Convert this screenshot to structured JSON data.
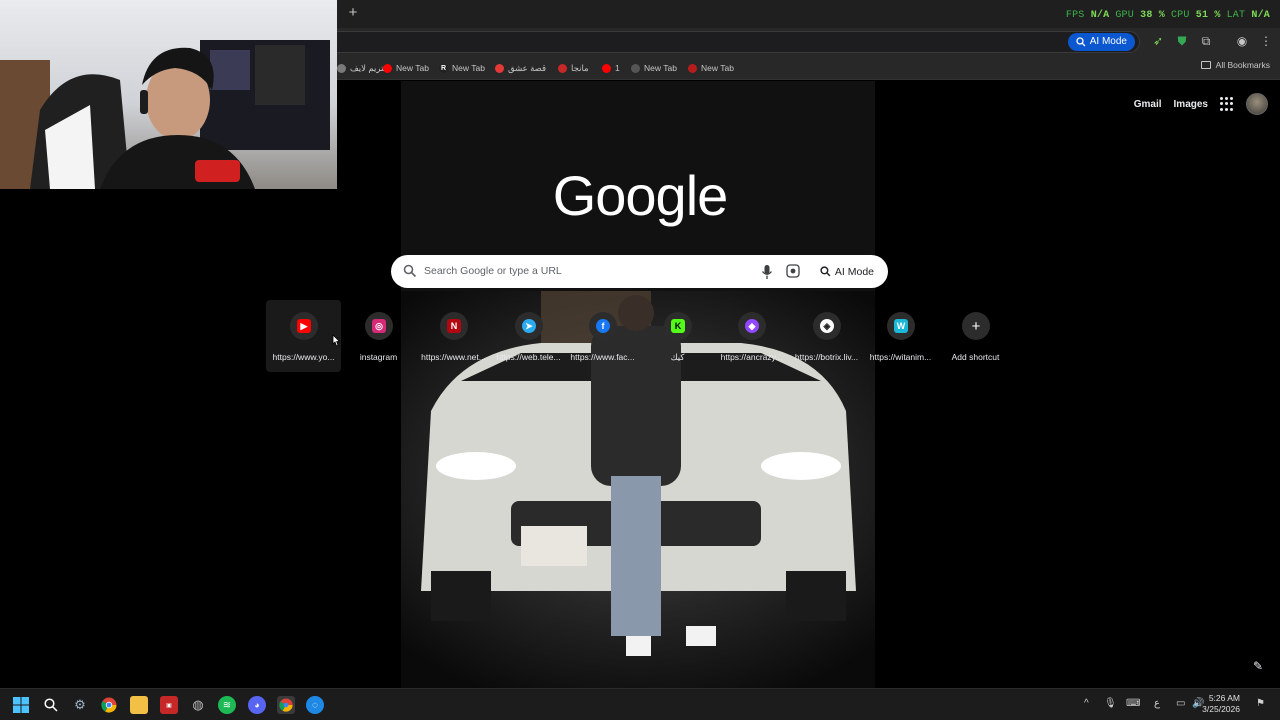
{
  "overlay": {
    "fps_label": "FPS",
    "fps_value": "N/A",
    "gpu_label": "GPU",
    "gpu_value": "38 %",
    "cpu_label": "CPU",
    "cpu_value": "51 %",
    "lat_label": "LAT",
    "lat_value": "N/A"
  },
  "toolbar": {
    "ai_mode_label": "AI Mode"
  },
  "bookmarks": {
    "items": [
      {
        "label": "ستريم لايف",
        "color": "#7a7a7a"
      },
      {
        "label": "New Tab",
        "color": "#ff0000"
      },
      {
        "label": "New Tab",
        "color": "#222222"
      },
      {
        "label": "قصة عشق",
        "color": "#e53935"
      },
      {
        "label": "مانجا",
        "color": "#c62828"
      },
      {
        "label": "1",
        "color": "#ff0000"
      },
      {
        "label": "New Tab",
        "color": "#555555"
      },
      {
        "label": "New Tab",
        "color": "#b71c1c"
      }
    ],
    "all_bookmarks_label": "All Bookmarks"
  },
  "header": {
    "gmail_label": "Gmail",
    "images_label": "Images"
  },
  "logo": "Google",
  "search": {
    "placeholder": "Search Google or type a URL",
    "ai_mode_label": "AI Mode"
  },
  "shortcuts": [
    {
      "label": "https://www.yo...",
      "icon": "youtube-icon",
      "color": "#ff0000",
      "glyph": "▶"
    },
    {
      "label": "instagram",
      "icon": "instagram-icon",
      "color": "#d62976",
      "glyph": "◎"
    },
    {
      "label": "https://www.net...",
      "icon": "netflix-icon",
      "color": "#b20710",
      "glyph": "N"
    },
    {
      "label": "https://web.tele...",
      "icon": "telegram-icon",
      "color": "#2aabee",
      "glyph": "➤"
    },
    {
      "label": "https://www.fac...",
      "icon": "facebook-icon",
      "color": "#1877f2",
      "glyph": "f"
    },
    {
      "label": "كيك",
      "icon": "kick-icon",
      "color": "#53fc18",
      "glyph": "K"
    },
    {
      "label": "https://ancrazy...",
      "icon": "twitch-icon",
      "color": "#9146ff",
      "glyph": "◆"
    },
    {
      "label": "https://botrix.liv...",
      "icon": "botrix-icon",
      "color": "#ffffff",
      "glyph": "◈"
    },
    {
      "label": "https://witanim...",
      "icon": "witanime-icon",
      "color": "#1ab7d6",
      "glyph": "W"
    },
    {
      "label": "Add shortcut",
      "icon": "plus-icon",
      "color": "#2c2c2c",
      "glyph": "+"
    }
  ],
  "taskbar": {
    "clock_time": "5:26 AM",
    "clock_date": "3/25/2026",
    "lang": "ع"
  }
}
